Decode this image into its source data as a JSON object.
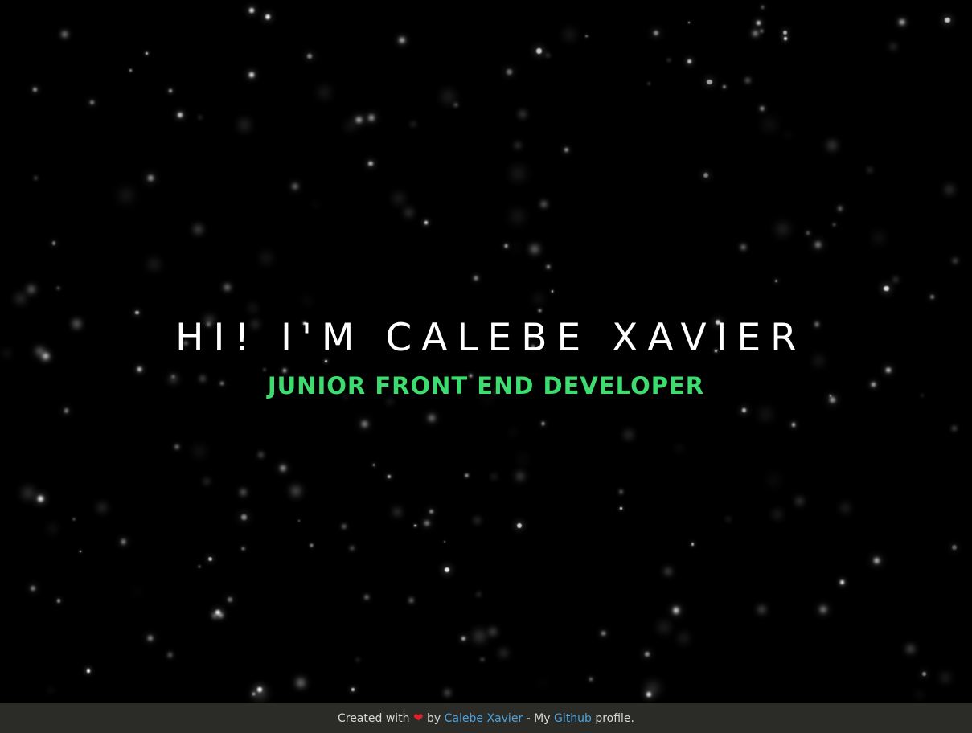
{
  "hero": {
    "title": "HI! I'M CALEBE XAVIER",
    "subtitle": "JUNIOR FRONT END DEVELOPER"
  },
  "footer": {
    "created_with": "Created with",
    "heart_icon": "heart-icon",
    "by": "by",
    "author_link": "Calebe Xavier",
    "separator": "- My",
    "github_link": "Github",
    "profile": "profile."
  },
  "colors": {
    "background": "#000000",
    "title": "#ffffff",
    "subtitle": "#3ddc6f",
    "footer_background": "#2b2b28",
    "footer_text": "#d8d8d8",
    "link": "#4aa3df",
    "heart": "#e0202a"
  }
}
